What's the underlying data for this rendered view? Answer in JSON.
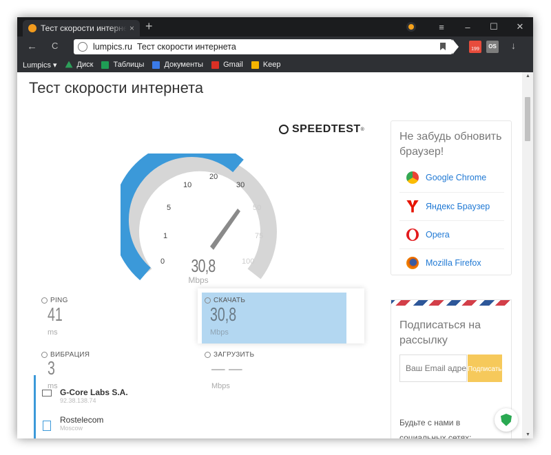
{
  "browser": {
    "tab_title": "Тест скорости интернета",
    "tab_close": "×",
    "new_tab": "+",
    "menu_icon": "≡",
    "minimize": "–",
    "maximize": "☐",
    "close": "✕",
    "back": "←",
    "reload": "C",
    "domain": "lumpics.ru",
    "page_title_in_omnibox": "Тест скорости интернета",
    "mail_count": "199",
    "os_badge": "OS",
    "download": "↓",
    "accent": "#f29b1d"
  },
  "bookmarks": [
    {
      "label": "Lumpics ▾",
      "icon": "",
      "color": ""
    },
    {
      "label": "Диск",
      "icon": "drive-icon",
      "color": "#2d9f5a"
    },
    {
      "label": "Таблицы",
      "icon": "sheets-icon",
      "color": "#1f9d55"
    },
    {
      "label": "Документы",
      "icon": "docs-icon",
      "color": "#3b7be8"
    },
    {
      "label": "Gmail",
      "icon": "gmail-icon",
      "color": "#d93025"
    },
    {
      "label": "Keep",
      "icon": "keep-icon",
      "color": "#f5b400"
    }
  ],
  "page": {
    "title": "Тест скорости интернета"
  },
  "speedtest": {
    "logo": "SPEEDTEST",
    "trademark": "®",
    "gauge_ticks": [
      "0",
      "1",
      "5",
      "10",
      "20",
      "30",
      "50",
      "75",
      "100"
    ],
    "gauge_value": "30,8",
    "gauge_unit": "Mbps",
    "gauge_fraction": 0.52,
    "accent": "#3b99d9",
    "ping": {
      "label": "PING",
      "value": "41",
      "unit": "ms"
    },
    "download": {
      "label": "СКАЧАТЬ",
      "value": "30,8",
      "unit": "Mbps"
    },
    "jitter": {
      "label": "ВИБРАЦИЯ",
      "value": "3",
      "unit": "ms"
    },
    "upload": {
      "label": "ЗАГРУЗИТЬ",
      "value": "— —",
      "unit": "Mbps"
    },
    "isp": {
      "name": "G-Core Labs S.A.",
      "ip": "92.38.138.74"
    },
    "server": {
      "name": "Rostelecom",
      "city": "Moscow"
    }
  },
  "sidebar": {
    "update_title": "Не забудь обновить браузер!",
    "browsers": [
      {
        "label": "Google Chrome",
        "icon": "chrome-icon",
        "color": "#4285f4"
      },
      {
        "label": "Яндекс Браузер",
        "icon": "yandex-icon",
        "color": "#e61400"
      },
      {
        "label": "Opera",
        "icon": "opera-icon",
        "color": "#e2191c"
      },
      {
        "label": "Mozilla Firefox",
        "icon": "firefox-icon",
        "color": "#e66000"
      }
    ],
    "subscribe_title": "Подписаться на рассылку",
    "email_placeholder": "Ваш Email адрес",
    "subscribe_button": "Подписаться",
    "social_text": "Будьте с нами в социальных сетях:"
  }
}
